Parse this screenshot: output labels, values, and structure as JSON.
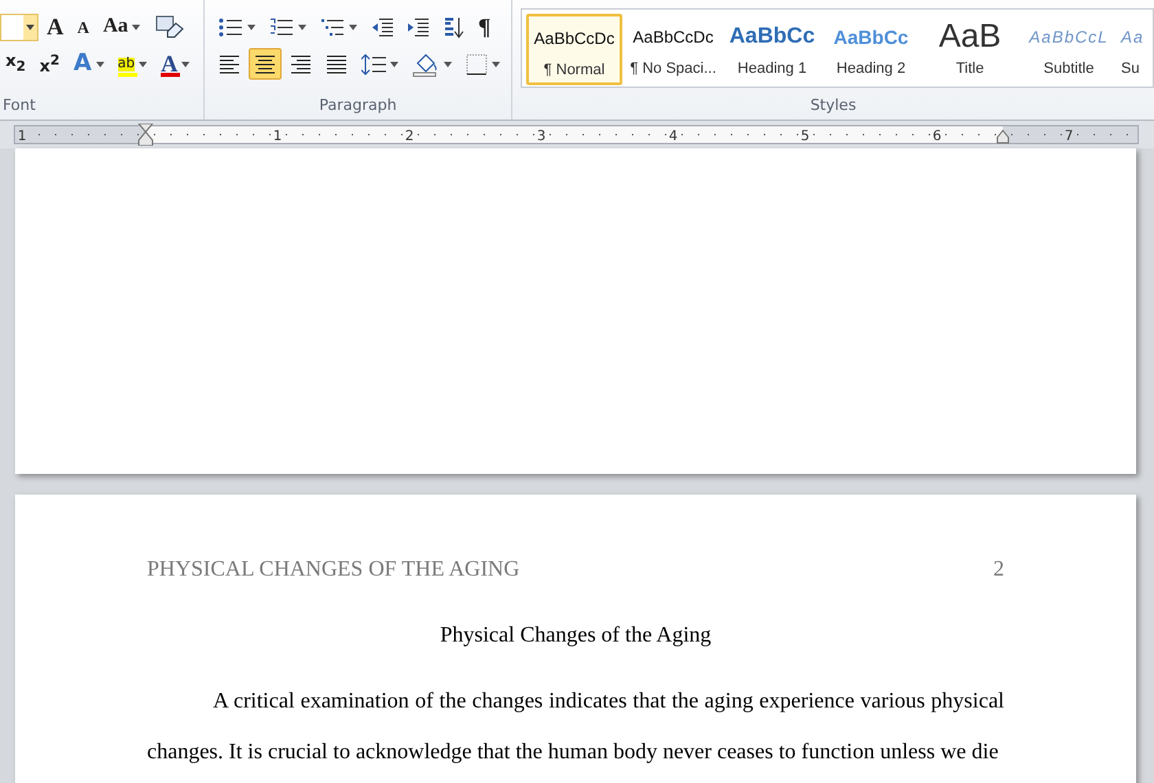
{
  "ribbon": {
    "font_group": {
      "label": "Font",
      "row_1": [
        {
          "kind": "size",
          "hovered": true
        },
        {
          "kind": "grow",
          "text": "A"
        },
        {
          "kind": "shrink",
          "text": "A"
        },
        {
          "kind": "case",
          "text": "Aa"
        },
        {
          "kind": "clear"
        }
      ],
      "row_2": [
        {
          "kind": "subscript",
          "text": "x$_{2}$"
        },
        {
          "kind": "superscript",
          "text": "x$^{2}$"
        },
        {
          "kind": "effects",
          "text": "A"
        },
        {
          "kind": "highlight",
          "text": "ab"
        },
        {
          "kind": "color",
          "text": "A"
        }
      ]
    },
    "paragraph_group": {
      "label": "Paragraph",
      "row_1": [
        {
          "kind": "bullets"
        },
        {
          "kind": "numbering"
        },
        {
          "kind": "multilevel"
        },
        {
          "kind": "outdent"
        },
        {
          "kind": "indent"
        },
        {
          "kind": "sort"
        },
        {
          "kind": "pilcrow",
          "text": "¶"
        }
      ],
      "row_2": [
        {
          "kind": "align-left",
          "selected": false
        },
        {
          "kind": "align-center",
          "selected": true
        },
        {
          "kind": "align-right",
          "selected": false
        },
        {
          "kind": "justify",
          "selected": false
        },
        {
          "kind": "line-spacing"
        },
        {
          "kind": "shading"
        },
        {
          "kind": "borders"
        }
      ]
    },
    "styles_group": {
      "label": "Styles",
      "items": [
        {
          "kind": "normal",
          "preview": "AaBbCcDc",
          "label": "¶ Normal",
          "selected": true
        },
        {
          "kind": "normal",
          "preview": "AaBbCcDc",
          "label": "¶ No Spaci...",
          "selected": false
        },
        {
          "kind": "heading1",
          "preview": "AaBbCc",
          "label": "Heading 1",
          "selected": false
        },
        {
          "kind": "heading2",
          "preview": "AaBbCc",
          "label": "Heading 2",
          "selected": false
        },
        {
          "kind": "title",
          "preview": "AaB",
          "label": "Title",
          "selected": false
        },
        {
          "kind": "subtitle",
          "preview": "AaBbCcL",
          "label": "Subtitle",
          "selected": false
        },
        {
          "kind": "subtitle",
          "preview": "Aa",
          "label": "Su",
          "selected": false
        }
      ]
    }
  },
  "ruler": {
    "numbers": [
      "1",
      "1",
      "2",
      "3",
      "4",
      "5",
      "6",
      "7"
    ]
  },
  "document": {
    "header": "PHYSICAL CHANGES OF THE AGING",
    "page_number": "2",
    "title": "Physical Changes of the Aging",
    "paragraph": "A critical examination of the changes indicates that the aging experience various physical changes. It is crucial to acknowledge that the human body never ceases to function unless we die"
  }
}
